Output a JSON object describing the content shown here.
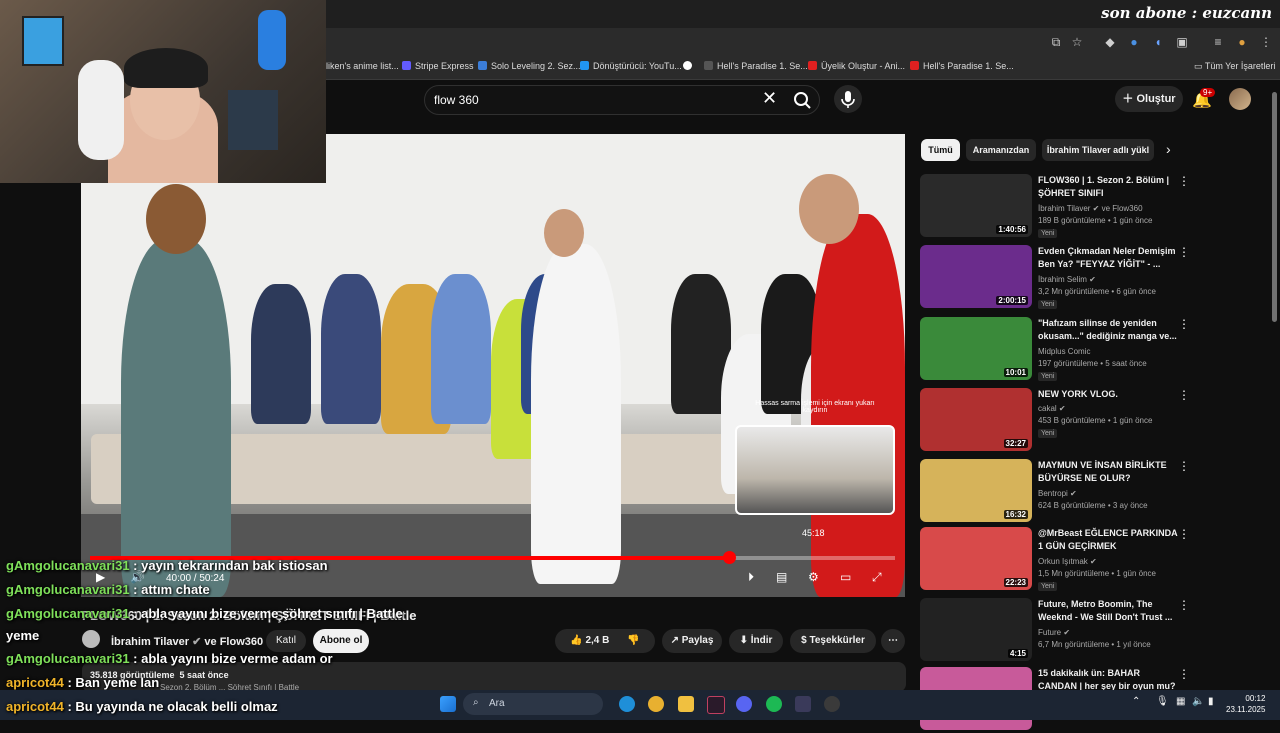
{
  "stream_overlay": "son abone : euzcann",
  "bookmarks": [
    {
      "label": "liken's anime list...",
      "color": "#2e51a2"
    },
    {
      "label": "Stripe Express",
      "color": "#635bff"
    },
    {
      "label": "Solo Leveling 2. Sez...",
      "color": "#3b7dd8"
    },
    {
      "label": "Dönüştürücü: YouTu...",
      "color": "#2196f3"
    },
    {
      "label": "",
      "color": "#ffffff"
    },
    {
      "label": "Hell's Paradise 1. Se...",
      "color": "#444444"
    },
    {
      "label": "Üyelik Oluştur - Ani...",
      "color": "#e02020"
    },
    {
      "label": "Hell's Paradise 1. Se...",
      "color": "#e02020"
    }
  ],
  "all_bookmarks": "Tüm Yer İşaretleri",
  "search": {
    "value": "flow 360"
  },
  "header": {
    "create_label": "Oluştur",
    "notif_badge": "9+"
  },
  "player": {
    "current_time": "40:00",
    "duration": "50:24",
    "time_display": "40:00 / 50:24",
    "progress_fraction": 0.7937,
    "preview_tip": "Hassas sarma işlemi için ekranı yukarı kaydırın",
    "preview_time": "45:18"
  },
  "video": {
    "title": "FLOW360 | 1. Sezon 2. Bölüm | ŞÖHRET SINIFI | Battle",
    "channel": "İbrahim Tilaver",
    "collab": "ve Flow360",
    "join_label": "Katıl",
    "subscribe_label": "Abone ol",
    "likes": "2,4 B",
    "share_label": "Paylaş",
    "download_label": "İndir",
    "thanks_label": "Teşekkürler",
    "views": "35.818 görüntüleme",
    "age": "5 saat önce",
    "desc_snippet": "Sezon 2. Bölüm ... Şöhret Sınıfı | Battle"
  },
  "chat": [
    {
      "user": "gAmgolucanavari31",
      "msg": ": yayın tekrarından bak istiosan",
      "color": "u1"
    },
    {
      "user": "gAmgolucanavari31",
      "msg": ": attım chate",
      "color": "u1"
    },
    {
      "user": "gAmgolucanavari31",
      "msg": ": abla yayını bize verme şöhret sınıfı | Battle",
      "color": "u1"
    },
    {
      "user": "",
      "msg": "yeme",
      "color": "u1"
    },
    {
      "user": "gAmgolucanavari31",
      "msg": ": abla yayını bize verme adam or",
      "color": "u1"
    },
    {
      "user": "apricot44",
      "msg": ": Ban yeme lan",
      "color": "u2"
    },
    {
      "user": "apricot44",
      "msg": ": Bu yayında ne olacak belli olmaz",
      "color": "u2"
    }
  ],
  "chips": [
    "Tümü",
    "Aramanızdan",
    "İbrahim Tilaver adlı yükl"
  ],
  "recommendations": [
    {
      "title": "FLOW360 | 1. Sezon 2. Bölüm | ŞÖHRET SINIFI",
      "channel": "İbrahim Tilaver ✔ ve Flow360",
      "meta": "189 B görüntüleme • 1 gün önce",
      "new": "Yeni",
      "duration": "1:40:56",
      "thumb": "#2a2a2a"
    },
    {
      "title": "Evden Çıkmadan Neler Demişim Ben Ya? \"FEYYAZ YİĞİT\" - ...",
      "channel": "İbrahim Selim ✔",
      "meta": "3,2 Mn görüntüleme • 6 gün önce",
      "new": "Yeni",
      "duration": "2:00:15",
      "thumb": "#6b2c8c"
    },
    {
      "title": "\"Hafızam silinse de yeniden okusam...\" dediğiniz manga ve...",
      "channel": "Midplus Comic",
      "meta": "197 görüntüleme • 5 saat önce",
      "new": "Yeni",
      "duration": "10:01",
      "thumb": "#3a8a3a"
    },
    {
      "title": "NEW YORK VLOG.",
      "channel": "cakal ✔",
      "meta": "453 B görüntüleme • 1 gün önce",
      "new": "Yeni",
      "duration": "32:27",
      "thumb": "#b03030"
    },
    {
      "title": "MAYMUN VE İNSAN BİRLİKTE BÜYÜRSE NE OLUR?",
      "channel": "Bentropi ✔",
      "meta": "624 B görüntüleme • 3 ay önce",
      "new": "",
      "duration": "16:32",
      "thumb": "#d6b35a"
    },
    {
      "title": "@MrBeast EĞLENCE PARKINDA 1 GÜN GEÇİRMEK",
      "channel": "Orkun Işıtmak ✔",
      "meta": "1,5 Mn görüntüleme • 1 gün önce",
      "new": "Yeni",
      "duration": "22:23",
      "thumb": "#d84a4a"
    },
    {
      "title": "Future, Metro Boomin, The Weeknd - We Still Don't Trust ...",
      "channel": "Future ✔",
      "meta": "6,7 Mn görüntüleme • 1 yıl önce",
      "new": "",
      "duration": "4:15",
      "thumb": "#222222"
    },
    {
      "title": "15 dakikalık ün: BAHAR CANDAN | her şey bir oyun mu?",
      "channel": "",
      "meta": "",
      "new": "",
      "duration": "",
      "thumb": "#c85a9a"
    }
  ],
  "taskbar": {
    "search_placeholder": "Ara",
    "time": "00:12",
    "date": "23.11.2025"
  }
}
